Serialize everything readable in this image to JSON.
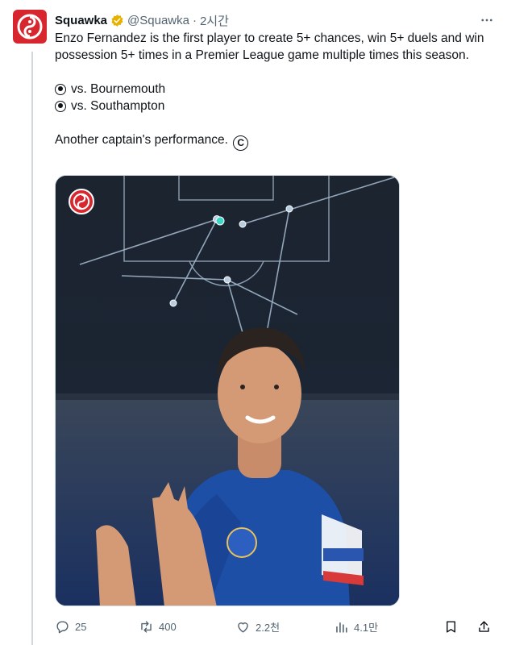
{
  "author": {
    "display_name": "Squawka",
    "handle": "@Squawka",
    "separator": "·",
    "time": "2시간",
    "avatar_icon": "squawka-logo-icon",
    "verified_color": "#e8b100"
  },
  "tweet": {
    "intro": "Enzo Fernandez is the first player to create 5+ chances, win 5+ duels and win possession 5+ times in a Premier League game multiple times this season.",
    "bullets": [
      "vs. Bournemouth",
      "vs. Southampton"
    ],
    "outro": "Another captain's performance.",
    "emoji_bullet": "radio-button-icon",
    "emoji_end": "copyright-icon"
  },
  "media": {
    "logo_icon": "squawka-logo-icon",
    "pitch_color": "#1c2430",
    "line_color": "#9fb4c8",
    "player_shirt_color": "#1d4fa6",
    "highlight_dot_color": "#3dd6c6"
  },
  "actions": {
    "reply_count": "25",
    "retweet_count": "400",
    "like_count": "2.2천",
    "view_count": "4.1만"
  }
}
